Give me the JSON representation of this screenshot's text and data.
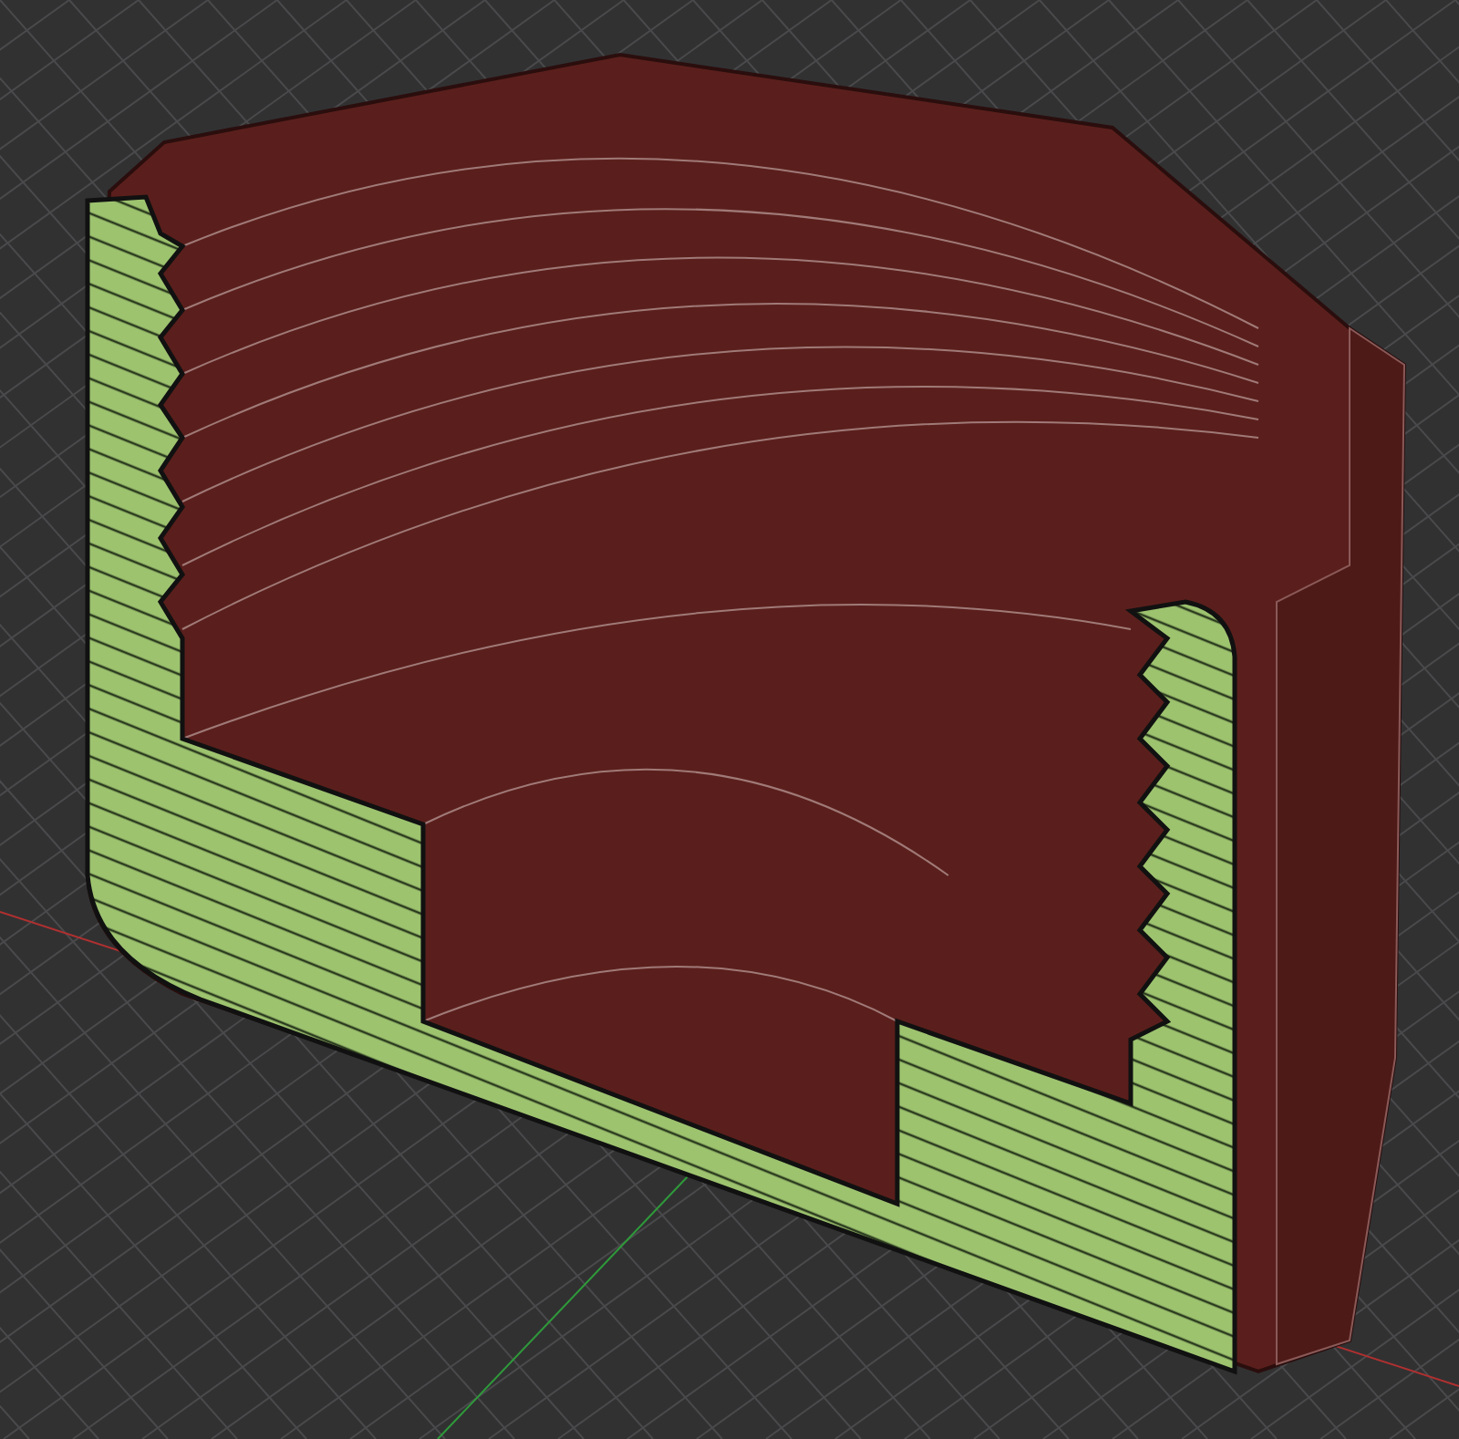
{
  "viewport": {
    "grid": true,
    "axes": true,
    "section_view": true
  }
}
